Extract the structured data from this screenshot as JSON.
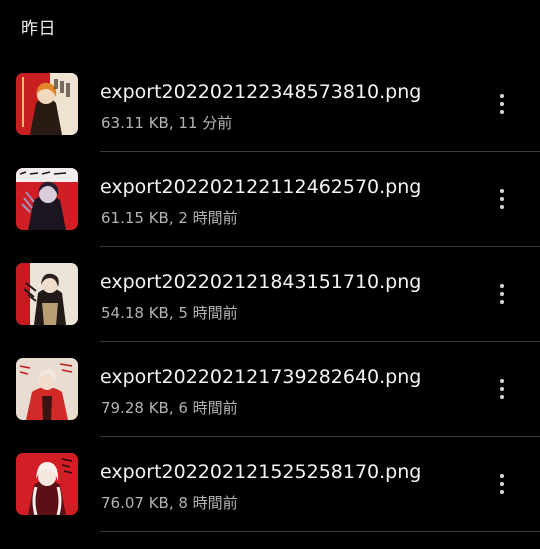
{
  "section": {
    "title": "昨日"
  },
  "files": [
    {
      "name": "export202202122348573810.png",
      "meta": "63.11 KB, 11 分前",
      "thumb_colors": {
        "bg": "#c71f1f",
        "accent": "#f0e2d0",
        "dark": "#2a1a14",
        "hair": "#e0872b"
      }
    },
    {
      "name": "export202202122112462570.png",
      "meta": "61.15 KB, 2 時間前",
      "thumb_colors": {
        "bg": "#cf1e24",
        "accent": "#d8ccd8",
        "dark": "#1c1420",
        "hair": "#2a1d2e"
      }
    },
    {
      "name": "export202202121843151710.png",
      "meta": "54.18 KB, 5 時間前",
      "thumb_colors": {
        "bg": "#ece4d8",
        "accent": "#b8a074",
        "dark": "#201a18",
        "hair": "#2b2220"
      }
    },
    {
      "name": "export202202121739282640.png",
      "meta": "79.28 KB, 6 時間前",
      "thumb_colors": {
        "bg": "#e8ddd0",
        "accent": "#d12a28",
        "dark": "#3a1410",
        "hair": "#efe7dc"
      }
    },
    {
      "name": "export202202121525258170.png",
      "meta": "76.07 KB, 8 時間前",
      "thumb_colors": {
        "bg": "#d31e26",
        "accent": "#f2e8e0",
        "dark": "#5a1014",
        "hair": "#f6f0ea"
      }
    }
  ],
  "icons": {
    "more": "more-vert-icon"
  }
}
